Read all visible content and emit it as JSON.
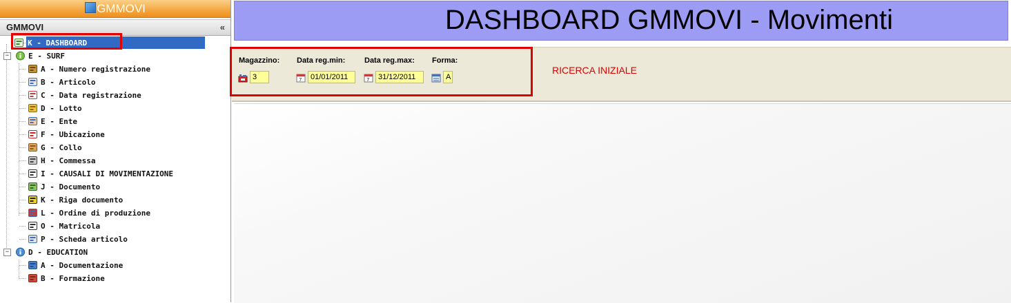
{
  "app": {
    "title": "GMMOVI"
  },
  "panel": {
    "header": "GMMOVI",
    "collapse_icon": "«"
  },
  "tree": [
    {
      "label": "K - DASHBOARD",
      "icon": "dashboard-arrow-icon",
      "level": 1,
      "selected": true
    },
    {
      "label": "E - SURF",
      "icon": "green-arrow-icon",
      "level": 0,
      "expanded": true
    },
    {
      "label": "A - Numero registrazione",
      "icon": "cart-icon",
      "level": 1
    },
    {
      "label": "B - Articolo",
      "icon": "article-icon",
      "level": 1
    },
    {
      "label": "C - Data registrazione",
      "icon": "calendar-icon",
      "level": 1
    },
    {
      "label": "D - Lotto",
      "icon": "lot-icon",
      "level": 1
    },
    {
      "label": "E - Ente",
      "icon": "person-icon",
      "level": 1
    },
    {
      "label": "F - Ubicazione",
      "icon": "location-icon",
      "level": 1
    },
    {
      "label": "G - Collo",
      "icon": "package-icon",
      "level": 1
    },
    {
      "label": "H - Commessa",
      "icon": "order-icon",
      "level": 1
    },
    {
      "label": "I - CAUSALI DI MOVIMENTAZIONE",
      "icon": "list-icon",
      "level": 1
    },
    {
      "label": "J - Documento",
      "icon": "document-icon",
      "level": 1
    },
    {
      "label": "K - Riga documento",
      "icon": "striped-icon",
      "level": 1
    },
    {
      "label": "L - Ordine di produzione",
      "icon": "grid-icon",
      "level": 1
    },
    {
      "label": "O - Matricola",
      "icon": "serial-icon",
      "level": 1
    },
    {
      "label": "P - Scheda articolo",
      "icon": "card-icon",
      "level": 1
    },
    {
      "label": "D - EDUCATION",
      "icon": "info-icon",
      "level": 0,
      "expanded": true
    },
    {
      "label": "A - Documentazione",
      "icon": "book-icon",
      "level": 1
    },
    {
      "label": "B - Formazione",
      "icon": "training-icon",
      "level": 1
    }
  ],
  "page": {
    "title": "DASHBOARD GMMOVI - Movimenti"
  },
  "search": {
    "fields": [
      {
        "label": "Magazzino:",
        "value": "3",
        "icon": "warehouse-icon"
      },
      {
        "label": "Data reg.min:",
        "value": "01/01/2011",
        "icon": "calendar-icon"
      },
      {
        "label": "Data reg.max:",
        "value": "31/12/2011",
        "icon": "calendar-icon"
      },
      {
        "label": "Forma:",
        "value": "A",
        "icon": "form-icon"
      }
    ],
    "note": "RICERCA INIZIALE"
  },
  "colors": {
    "title_bg": "#9c9cf5",
    "highlight": "#e00000",
    "selection": "#316ac5",
    "field_bg": "#ffff99",
    "appbar": "#f4a63e"
  }
}
